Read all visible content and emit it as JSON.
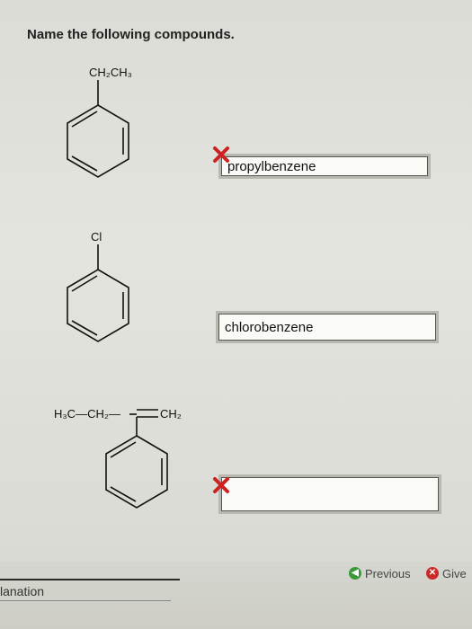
{
  "heading": "Name the following compounds.",
  "questions": [
    {
      "substituent": "CH₂CH₃",
      "answer": "propylbenzene",
      "status": "incorrect"
    },
    {
      "substituent": "Cl",
      "answer": "chlorobenzene",
      "status": "none"
    },
    {
      "substituent_left": "H₃C—CH₂—",
      "substituent_right": "CH₂",
      "answer": "",
      "status": "incorrect"
    }
  ],
  "nav": {
    "previous_label": "Previous",
    "give_label": "Give"
  },
  "explanation_tab": "lanation",
  "colors": {
    "incorrect_mark": "#cc2222",
    "previous_icon": "#3a9a3a",
    "give_icon": "#cc2a2a"
  }
}
